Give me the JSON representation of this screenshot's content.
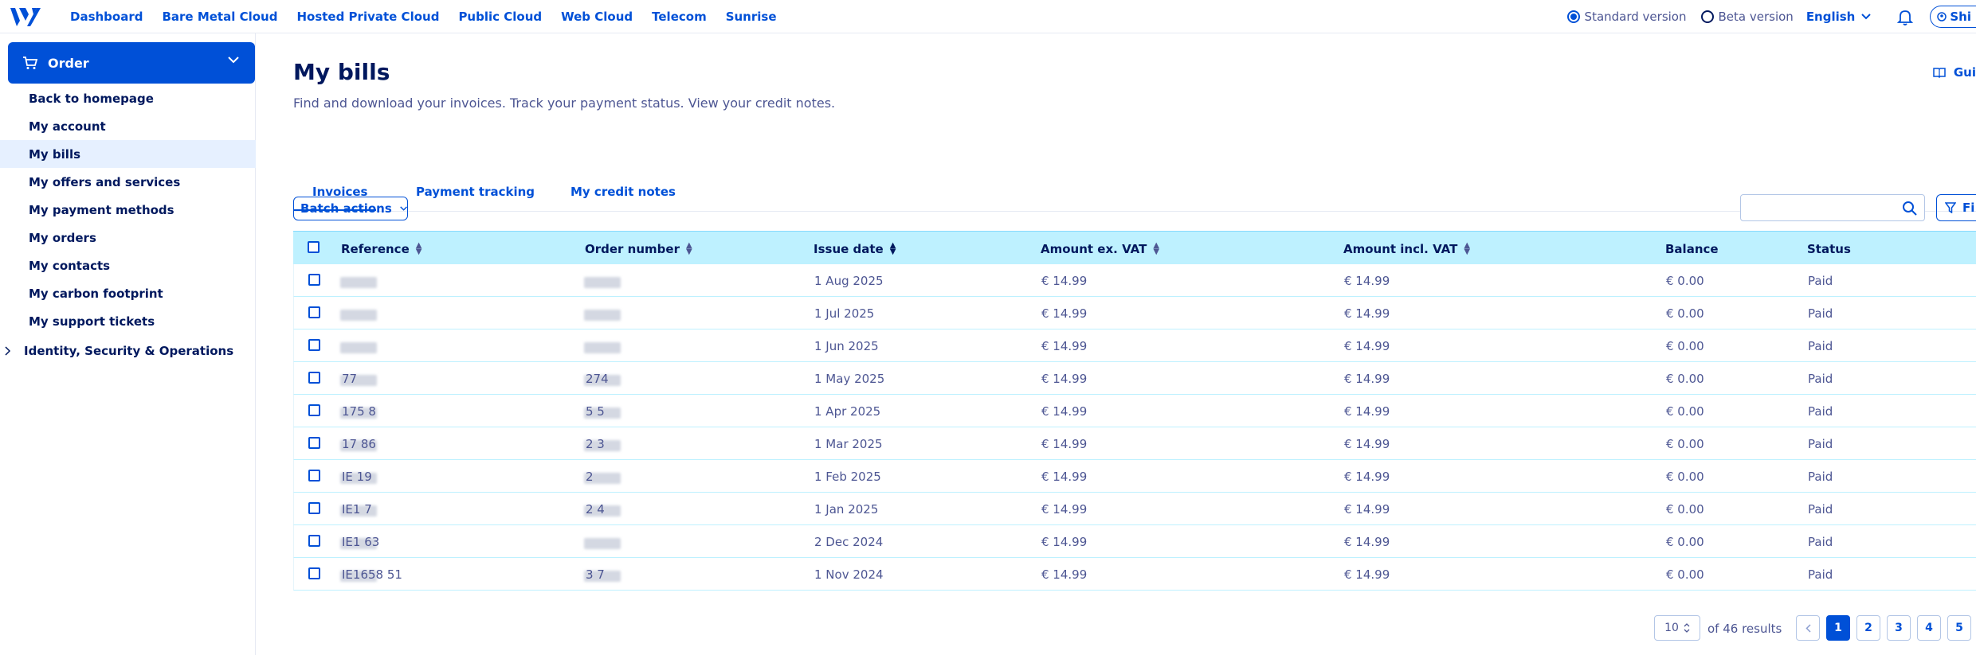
{
  "topnav": {
    "items": [
      "Dashboard",
      "Bare Metal Cloud",
      "Hosted Private Cloud",
      "Public Cloud",
      "Web Cloud",
      "Telecom",
      "Sunrise"
    ],
    "standard_version": "Standard version",
    "beta_version": "Beta version",
    "language": "English",
    "user_label": "Shi"
  },
  "sidebar": {
    "order_label": "Order",
    "items": [
      "Back to homepage",
      "My account",
      "My bills",
      "My offers and services",
      "My payment methods",
      "My orders",
      "My contacts",
      "My carbon footprint",
      "My support tickets"
    ],
    "active_index": 2,
    "group_label": "Identity, Security & Operations"
  },
  "page": {
    "title": "My bills",
    "subtitle": "Find and download your invoices. Track your payment status. View your credit notes.",
    "guides_label": "Gui"
  },
  "tabs": [
    "Invoices",
    "Payment tracking",
    "My credit notes"
  ],
  "toolbar": {
    "batch_actions": "Batch actions",
    "search_placeholder": "",
    "filter_label": "Fi"
  },
  "table": {
    "columns": [
      "Reference",
      "Order number",
      "Issue date",
      "Amount ex. VAT",
      "Amount incl. VAT",
      "Balance",
      "Status"
    ],
    "rows": [
      {
        "reference": "",
        "order": "",
        "date": "1 Aug 2025",
        "ex_vat": "€ 14.99",
        "incl_vat": "€ 14.99",
        "balance": "€ 0.00",
        "status": "Paid"
      },
      {
        "reference": "",
        "order": "",
        "date": "1 Jul 2025",
        "ex_vat": "€ 14.99",
        "incl_vat": "€ 14.99",
        "balance": "€ 0.00",
        "status": "Paid"
      },
      {
        "reference": "",
        "order": "",
        "date": "1 Jun 2025",
        "ex_vat": "€ 14.99",
        "incl_vat": "€ 14.99",
        "balance": "€ 0.00",
        "status": "Paid"
      },
      {
        "reference": "77",
        "order": "274",
        "date": "1 May 2025",
        "ex_vat": "€ 14.99",
        "incl_vat": "€ 14.99",
        "balance": "€ 0.00",
        "status": "Paid"
      },
      {
        "reference": "175 8",
        "order": "5 5",
        "date": "1 Apr 2025",
        "ex_vat": "€ 14.99",
        "incl_vat": "€ 14.99",
        "balance": "€ 0.00",
        "status": "Paid"
      },
      {
        "reference": "17 86",
        "order": "2 3",
        "date": "1 Mar 2025",
        "ex_vat": "€ 14.99",
        "incl_vat": "€ 14.99",
        "balance": "€ 0.00",
        "status": "Paid"
      },
      {
        "reference": "IE 19",
        "order": "2",
        "date": "1 Feb 2025",
        "ex_vat": "€ 14.99",
        "incl_vat": "€ 14.99",
        "balance": "€ 0.00",
        "status": "Paid"
      },
      {
        "reference": "IE1 7",
        "order": "2 4",
        "date": "1 Jan 2025",
        "ex_vat": "€ 14.99",
        "incl_vat": "€ 14.99",
        "balance": "€ 0.00",
        "status": "Paid"
      },
      {
        "reference": "IE1 63",
        "order": "",
        "date": "2 Dec 2024",
        "ex_vat": "€ 14.99",
        "incl_vat": "€ 14.99",
        "balance": "€ 0.00",
        "status": "Paid"
      },
      {
        "reference": "IE1658 51",
        "order": "3 7",
        "date": "1 Nov 2024",
        "ex_vat": "€ 14.99",
        "incl_vat": "€ 14.99",
        "balance": "€ 0.00",
        "status": "Paid"
      }
    ]
  },
  "pagination": {
    "per_page": "10",
    "results_text": "of 46 results",
    "pages": [
      "1",
      "2",
      "3",
      "4",
      "5"
    ],
    "current": "1"
  },
  "colors": {
    "primary": "#0050d7",
    "navy": "#00185e",
    "header_bg": "#bef1ff",
    "active_bg": "#e6f0ff"
  }
}
